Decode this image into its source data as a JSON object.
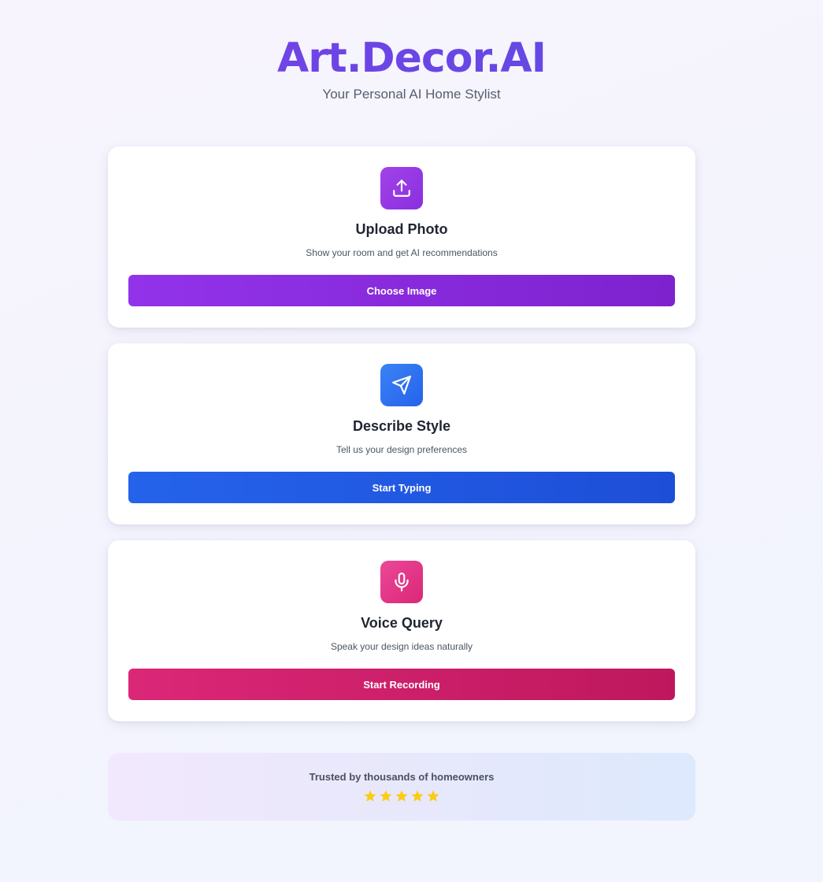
{
  "header": {
    "brand": "Art.Decor.AI",
    "tagline": "Your Personal AI Home Stylist"
  },
  "cards": [
    {
      "icon": "upload-icon",
      "title": "Upload Photo",
      "subtitle": "Show your room and get AI recommendations",
      "button": "Choose Image",
      "accent": "#9333ea"
    },
    {
      "icon": "send-icon",
      "title": "Describe Style",
      "subtitle": "Tell us your design preferences",
      "button": "Start Typing",
      "accent": "#2563eb"
    },
    {
      "icon": "microphone-icon",
      "title": "Voice Query",
      "subtitle": "Speak your design ideas naturally",
      "button": "Start Recording",
      "accent": "#db2777"
    }
  ],
  "trust": {
    "text": "Trusted by thousands of homeowners",
    "rating": 5,
    "max_rating": 5,
    "star_color": "#facc15"
  }
}
